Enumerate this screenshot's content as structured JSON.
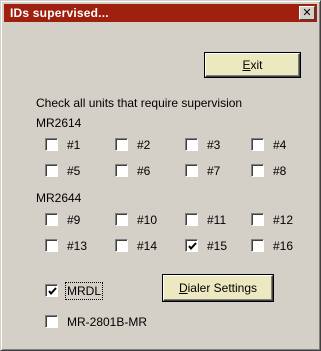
{
  "window": {
    "title": "IDs supervised...",
    "close_symbol": "✕",
    "colors": {
      "titlebar": "#a0200f",
      "face": "#d4d0c8",
      "button": "#ece9c0"
    }
  },
  "exit_button": {
    "underline": "E",
    "rest": "xit"
  },
  "instruction": "Check all units that require supervision",
  "groups": [
    {
      "title": "MR2614",
      "units": [
        {
          "label": "#1",
          "checked": false
        },
        {
          "label": "#2",
          "checked": false
        },
        {
          "label": "#3",
          "checked": false
        },
        {
          "label": "#4",
          "checked": false
        },
        {
          "label": "#5",
          "checked": false
        },
        {
          "label": "#6",
          "checked": false
        },
        {
          "label": "#7",
          "checked": false
        },
        {
          "label": "#8",
          "checked": false
        }
      ]
    },
    {
      "title": "MR2644",
      "units": [
        {
          "label": "#9",
          "checked": false
        },
        {
          "label": "#10",
          "checked": false
        },
        {
          "label": "#11",
          "checked": false
        },
        {
          "label": "#12",
          "checked": false
        },
        {
          "label": "#13",
          "checked": false
        },
        {
          "label": "#14",
          "checked": false
        },
        {
          "label": "#15",
          "checked": true
        },
        {
          "label": "#16",
          "checked": false
        }
      ]
    }
  ],
  "mrdl": {
    "label": "MRDL",
    "checked": true
  },
  "mr2801": {
    "label": "MR-2801B-MR",
    "checked": false
  },
  "dialer_button": {
    "underline": "D",
    "rest": "ialer Settings"
  }
}
